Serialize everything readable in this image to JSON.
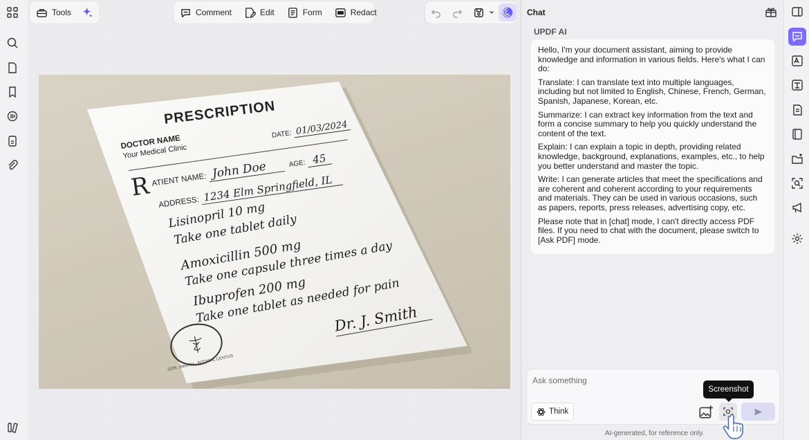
{
  "toolbar": {
    "tools_label": "Tools",
    "comment_label": "Comment",
    "edit_label": "Edit",
    "form_label": "Form",
    "redact_label": "Redact"
  },
  "prescription": {
    "heading": "PRESCRIPTION",
    "doctor_name": "DOCTOR NAME",
    "clinic": "Your Medical Clinic",
    "date_label": "DATE:",
    "date_value": "01/03/2024",
    "rx": "R",
    "patient_label": "ATIENT NAME:",
    "patient_value": "John Doe",
    "age_label": "AGE:",
    "age_value": "45",
    "address_label": "ADDRESS:",
    "address_value": "1234 Elm Springfield, IL",
    "lines": [
      "Lisinopril 10 mg",
      "Take one tablet daily",
      "Amoxicillin 500 mg",
      "Take one capsule three times a day",
      "Ibuprofen 200 mg",
      "Take one tablet as needed for pain"
    ],
    "signature": "Dr. J. Smith",
    "seal_text": "DOR. SMATIH · BODICAL CENTUS"
  },
  "chat": {
    "title": "Chat",
    "ai_name": "UPDF AI",
    "paragraphs": [
      "Hello, I'm your document assistant, aiming to provide knowledge and information in various fields. Here's what I can do:",
      "Translate: I can translate text into multiple languages, including but not limited to English, Chinese, French, German, Spanish, Japanese, Korean, etc.",
      "Summarize: I can extract key information from the text and form a concise summary to help you quickly understand the content of the text.",
      "Explain: I can explain a topic in depth, providing related knowledge, background, explanations, examples, etc., to help you better understand and master the topic.",
      "Write: I can generate articles that meet the specifications and are coherent and coherent according to your requirements and materials. They can be used in various occasions, such as papers, reports, press releases, advertising copy, etc.",
      "Please note that in [chat] mode, I can't directly access PDF files. If you need to chat with the document, please switch to [Ask PDF] mode."
    ],
    "input_placeholder": "Ask something",
    "think_label": "Think",
    "tooltip": "Screenshot",
    "footer": "AI-generated, for reference only."
  },
  "colors": {
    "accent": "#7b6cf6",
    "send_bg": "#dcdcf3"
  }
}
